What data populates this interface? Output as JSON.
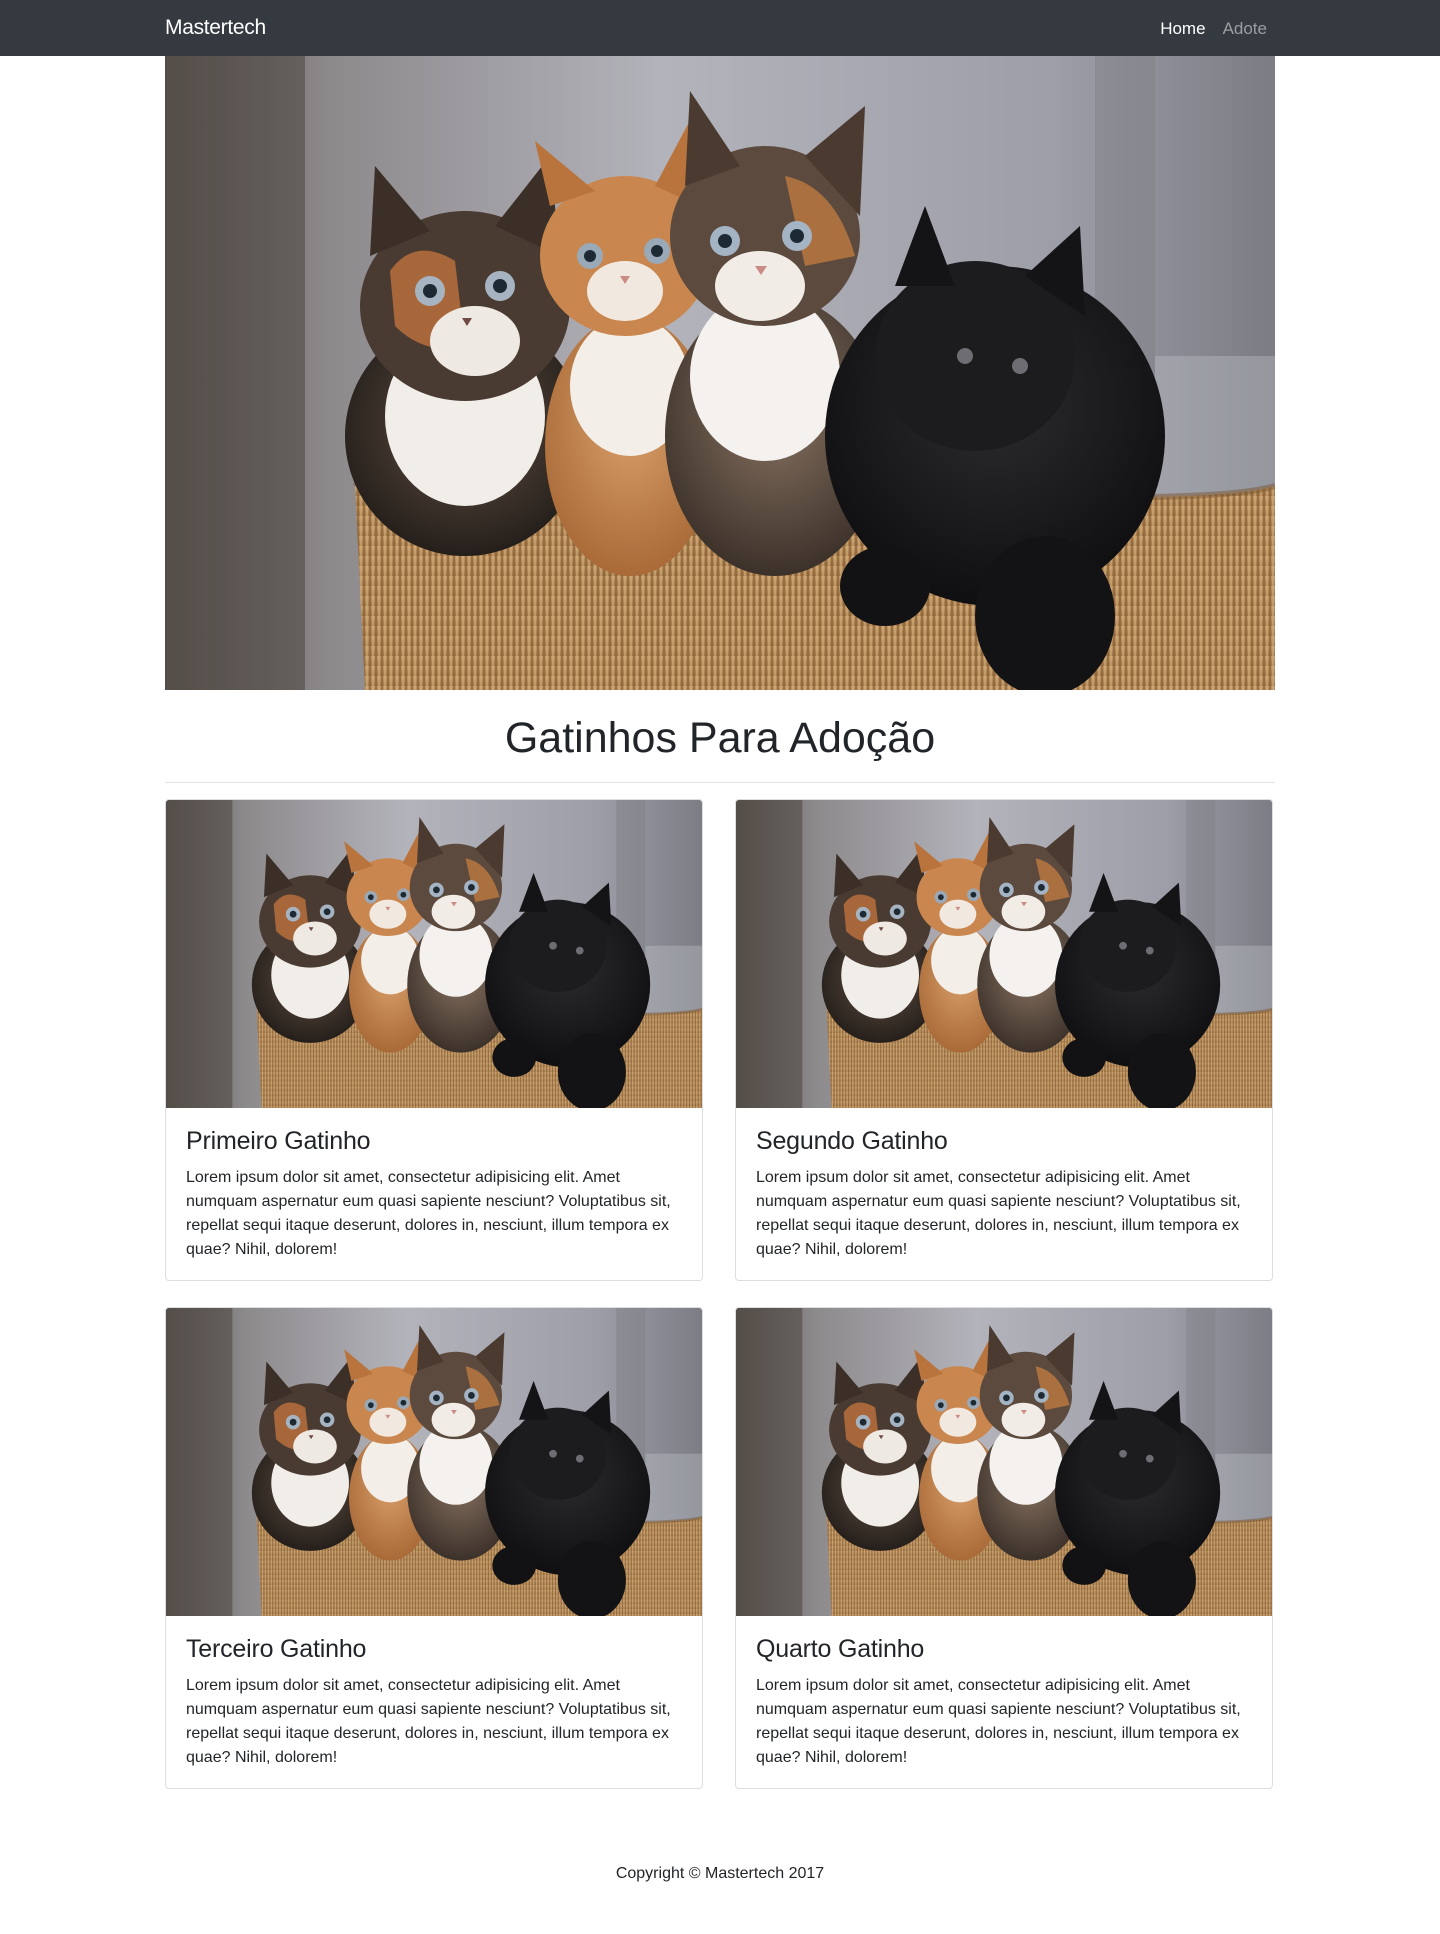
{
  "navbar": {
    "brand": "Mastertech",
    "links": [
      {
        "label": "Home",
        "active": true
      },
      {
        "label": "Adote",
        "active": false
      }
    ]
  },
  "hero": {
    "image": "four-kittens-in-basket-photo"
  },
  "main": {
    "title": "Gatinhos Para Adoção",
    "cards": [
      {
        "title": "Primeiro Gatinho",
        "text": "Lorem ipsum dolor sit amet, consectetur adipisicing elit. Amet numquam aspernatur eum quasi sapiente nesciunt? Voluptatibus sit, repellat sequi itaque deserunt, dolores in, nesciunt, illum tempora ex quae? Nihil, dolorem!",
        "image": "four-kittens-in-basket-photo"
      },
      {
        "title": "Segundo Gatinho",
        "text": "Lorem ipsum dolor sit amet, consectetur adipisicing elit. Amet numquam aspernatur eum quasi sapiente nesciunt? Voluptatibus sit, repellat sequi itaque deserunt, dolores in, nesciunt, illum tempora ex quae? Nihil, dolorem!",
        "image": "four-kittens-in-basket-photo"
      },
      {
        "title": "Terceiro Gatinho",
        "text": "Lorem ipsum dolor sit amet, consectetur adipisicing elit. Amet numquam aspernatur eum quasi sapiente nesciunt? Voluptatibus sit, repellat sequi itaque deserunt, dolores in, nesciunt, illum tempora ex quae? Nihil, dolorem!",
        "image": "four-kittens-in-basket-photo"
      },
      {
        "title": "Quarto Gatinho",
        "text": "Lorem ipsum dolor sit amet, consectetur adipisicing elit. Amet numquam aspernatur eum quasi sapiente nesciunt? Voluptatibus sit, repellat sequi itaque deserunt, dolores in, nesciunt, illum tempora ex quae? Nihil, dolorem!",
        "image": "four-kittens-in-basket-photo"
      }
    ]
  },
  "footer": {
    "copyright": "Copyright © Mastertech 2017"
  },
  "colors": {
    "navbar_bg": "#343a40",
    "nav_active": "#ffffff",
    "nav_inactive": "#8b8f93",
    "text": "#212529",
    "card_border": "#dcdfe2"
  }
}
